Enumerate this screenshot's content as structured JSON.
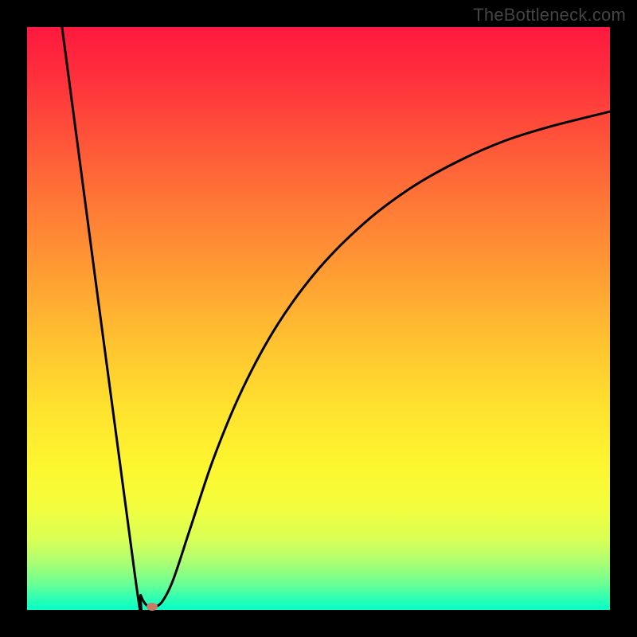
{
  "watermark": "TheBottleneck.com",
  "chart_data": {
    "type": "line",
    "title": "",
    "xlabel": "",
    "ylabel": "",
    "xlim": [
      0,
      100
    ],
    "ylim": [
      0,
      100
    ],
    "series": [
      {
        "name": "curve",
        "points": [
          {
            "x": 6.0,
            "y": 100.0
          },
          {
            "x": 18.5,
            "y": 6.0
          },
          {
            "x": 19.5,
            "y": 2.5
          },
          {
            "x": 20.5,
            "y": 0.8
          },
          {
            "x": 21.5,
            "y": 0.6
          },
          {
            "x": 23.0,
            "y": 1.2
          },
          {
            "x": 25.0,
            "y": 5.0
          },
          {
            "x": 28.0,
            "y": 14.0
          },
          {
            "x": 32.0,
            "y": 26.0
          },
          {
            "x": 37.0,
            "y": 38.0
          },
          {
            "x": 43.0,
            "y": 49.0
          },
          {
            "x": 50.0,
            "y": 58.5
          },
          {
            "x": 58.0,
            "y": 66.5
          },
          {
            "x": 66.0,
            "y": 72.5
          },
          {
            "x": 74.0,
            "y": 77.0
          },
          {
            "x": 82.0,
            "y": 80.5
          },
          {
            "x": 90.0,
            "y": 83.0
          },
          {
            "x": 100.0,
            "y": 85.5
          }
        ]
      }
    ],
    "marker": {
      "x": 21.5,
      "y": 0.5,
      "color": "#cb7b62"
    },
    "background_gradient": {
      "top": "#ff193f",
      "bottom": "#07ffc8"
    }
  }
}
